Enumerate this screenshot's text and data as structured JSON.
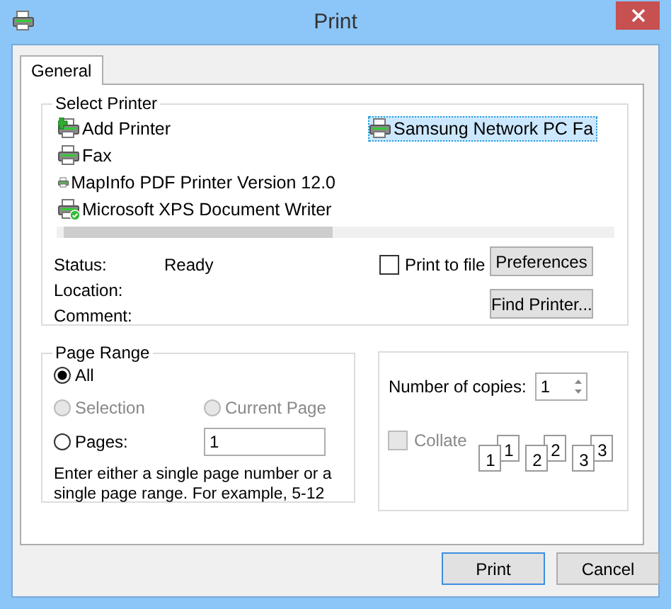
{
  "window": {
    "title": "Print"
  },
  "tabs": [
    {
      "label": "General",
      "selected": true
    }
  ],
  "select_printer": {
    "title": "Select Printer",
    "printers": [
      {
        "name": "Add Printer",
        "kind": "add",
        "selected": false
      },
      {
        "name": "Fax",
        "kind": "fax",
        "selected": false
      },
      {
        "name": "MapInfo PDF Printer Version 12.0",
        "kind": "printer",
        "selected": false
      },
      {
        "name": "Microsoft XPS Document Writer",
        "kind": "default",
        "selected": false
      },
      {
        "name": "Samsung Network PC Fa",
        "kind": "fax",
        "selected": true
      }
    ],
    "status_label": "Status:",
    "status_value": "Ready",
    "location_label": "Location:",
    "comment_label": "Comment:",
    "print_to_file": {
      "label": "Print to file",
      "checked": false
    },
    "preferences_button": "Preferences",
    "find_printer_button": "Find Printer..."
  },
  "page_range": {
    "title": "Page Range",
    "options": [
      {
        "label": "All",
        "selected": true,
        "disabled": false
      },
      {
        "label": "Selection",
        "selected": false,
        "disabled": true
      },
      {
        "label": "Current Page",
        "selected": false,
        "disabled": true
      },
      {
        "label": "Pages:",
        "selected": false,
        "disabled": false
      }
    ],
    "pages_value": "1",
    "hint": "Enter either a single page number or a single page range.  For example, 5-12"
  },
  "copies": {
    "label": "Number of copies:",
    "value": "1",
    "collate": {
      "label": "Collate",
      "checked": false,
      "disabled": true
    },
    "stacks": [
      {
        "back": "1",
        "front": "1"
      },
      {
        "back": "2",
        "front": "2"
      },
      {
        "back": "3",
        "front": "3"
      }
    ]
  },
  "buttons": [
    {
      "label": "Print",
      "default": true
    },
    {
      "label": "Cancel",
      "default": false
    }
  ]
}
